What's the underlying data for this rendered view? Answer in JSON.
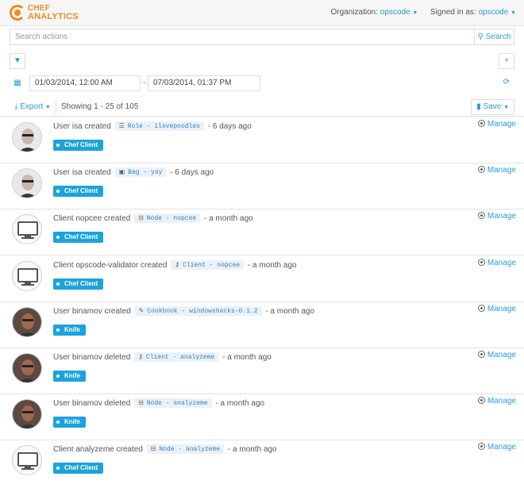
{
  "header": {
    "logo_line1": "CHEF",
    "logo_line2": "ANALYTICS",
    "org_label": "Organization:",
    "org_value": "opscode",
    "signed_label": "Signed in as:",
    "signed_value": "opscode"
  },
  "search": {
    "placeholder": "Search actions",
    "button_label": "Search"
  },
  "dates": {
    "start": "01/03/2014, 12:00 AM",
    "separator": "-",
    "end": "07/03/2014, 01:37 PM"
  },
  "toolbar": {
    "export_label": "Export",
    "showing": "Showing 1 - 25 of 105",
    "save_label": "Save"
  },
  "feed": [
    {
      "actor": "User isa created",
      "object": "Role - ilovepoodles",
      "object_icon": "role-icon",
      "time": "- 6 days ago",
      "tag": "Chef Client",
      "avatar": "person",
      "manage": "Manage"
    },
    {
      "actor": "User isa created",
      "object": "Bag - yay",
      "object_icon": "data-bag-icon",
      "time": "- 6 days ago",
      "tag": "Chef Client",
      "avatar": "person",
      "manage": "Manage"
    },
    {
      "actor": "Client nopcee created",
      "object": "Node - nopcee",
      "object_icon": "node-icon",
      "time": "- a month ago",
      "tag": "Chef Client",
      "avatar": "monitor",
      "manage": "Manage"
    },
    {
      "actor": "Client opscode-validator created",
      "object": "Client - nopcee",
      "object_icon": "key-icon",
      "time": "- a month ago",
      "tag": "Chef Client",
      "avatar": "monitor",
      "manage": "Manage"
    },
    {
      "actor": "User binamov created",
      "object": "Cookbook - windowshacks-0.1.2",
      "object_icon": "cookbook-icon",
      "time": "- a month ago",
      "tag": "Knife",
      "avatar": "person2",
      "manage": "Manage"
    },
    {
      "actor": "User binamov deleted",
      "object": "Client - analyzeme",
      "object_icon": "key-icon",
      "time": "- a month ago",
      "tag": "Knife",
      "avatar": "person2",
      "manage": "Manage"
    },
    {
      "actor": "User binamov deleted",
      "object": "Node - analyzeme",
      "object_icon": "node-icon",
      "time": "- a month ago",
      "tag": "Knife",
      "avatar": "person2",
      "manage": "Manage"
    },
    {
      "actor": "Client analyzeme created",
      "object": "Node - analyzeme",
      "object_icon": "node-icon",
      "time": "- a month ago",
      "tag": "Chef Client",
      "avatar": "monitor",
      "manage": "Manage"
    }
  ],
  "colors": {
    "accent": "#2a9bd6",
    "brand": "#f18b21",
    "tag": "#1da3dc"
  }
}
